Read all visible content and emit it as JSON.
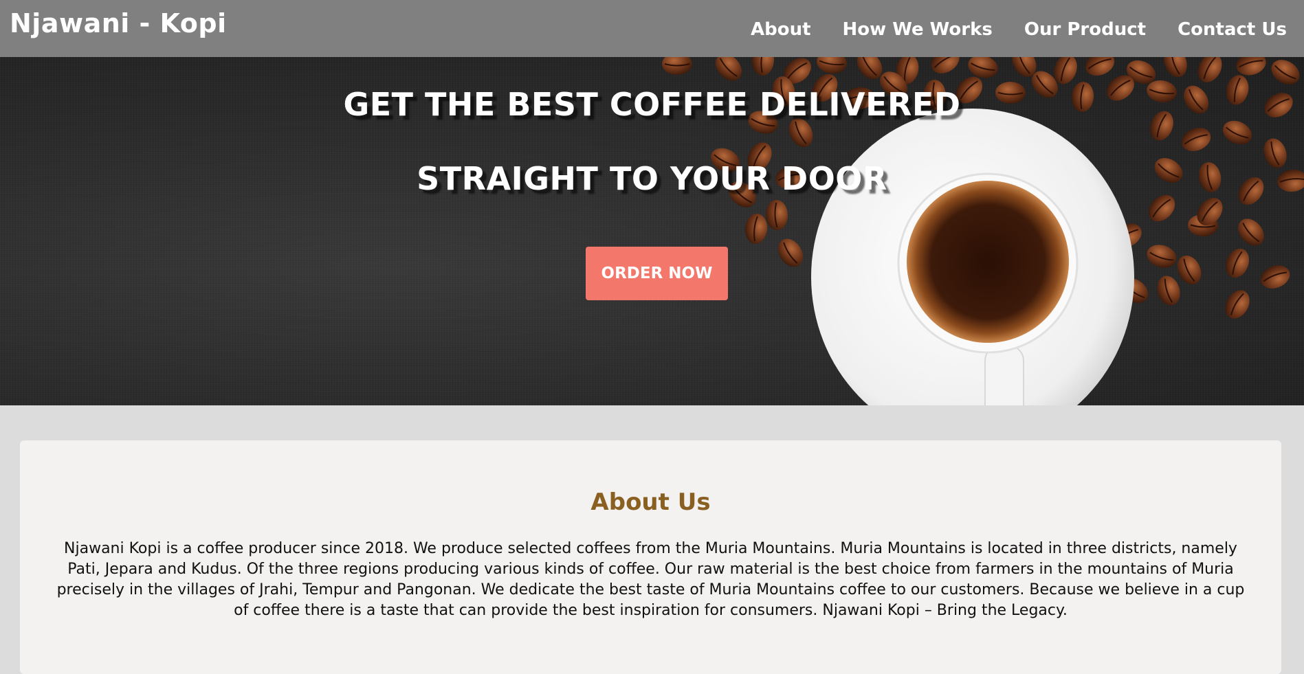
{
  "navbar": {
    "brand": "Njawani - Kopi",
    "links": [
      {
        "label": "About"
      },
      {
        "label": "How We Works"
      },
      {
        "label": "Our Product"
      },
      {
        "label": "Contact Us"
      }
    ]
  },
  "hero": {
    "title_line1": "GET THE BEST COFFEE DELIVERED",
    "title_line2": "STRAIGHT TO YOUR DOOR",
    "cta_label": "ORDER NOW",
    "image_description_icon": "coffee-cup-with-beans"
  },
  "about": {
    "title": "About Us",
    "text": "Njawani Kopi is a coffee producer since 2018. We produce selected coffees from the Muria Mountains. Muria Mountains is located in three districts, namely Pati, Jepara and Kudus. Of the three regions producing various kinds of coffee. Our raw material is the best choice from farmers in the mountains of Muria precisely in the villages of Jrahi, Tempur and Pangonan. We dedicate the best taste of Muria Mountains coffee to our customers. Because we believe in a cup of coffee there is a taste that can provide the best inspiration for consumers. Njawani Kopi – Bring the Legacy."
  },
  "colors": {
    "navbar_bg": "#808080",
    "cta_bg": "#f4776b",
    "about_title": "#8a5f22",
    "page_bg": "#dcdcdc",
    "card_bg": "#f3f2f1"
  }
}
